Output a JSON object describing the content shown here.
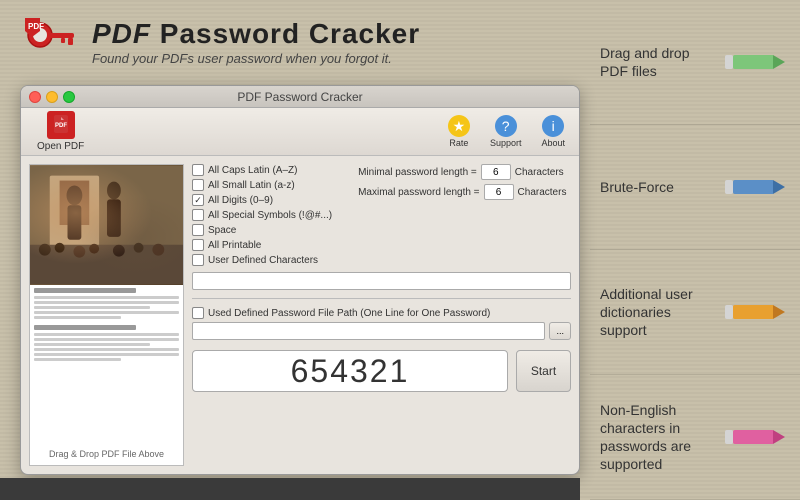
{
  "header": {
    "title_part1": "PDF",
    "title_part2": "Password Cracker",
    "subtitle": "Found your PDFs user password when you forgot it.",
    "logo_alt": "PDF Password Cracker logo"
  },
  "window": {
    "title": "PDF Password Cracker",
    "toolbar": {
      "open_pdf_label": "Open PDF",
      "rate_label": "Rate",
      "support_label": "Support",
      "about_label": "About"
    }
  },
  "checkboxes": [
    {
      "id": "all_caps",
      "label": "All Caps Latin (A–Z)",
      "checked": false
    },
    {
      "id": "all_small",
      "label": "All Small Latin (a-z)",
      "checked": false
    },
    {
      "id": "all_digits",
      "label": "All Digits (0–9)",
      "checked": true
    },
    {
      "id": "all_special",
      "label": "All Special Symbols (!@#...)",
      "checked": false
    },
    {
      "id": "space",
      "label": "Space",
      "checked": false
    },
    {
      "id": "all_printable",
      "label": "All Printable",
      "checked": false
    },
    {
      "id": "user_defined",
      "label": "User Defined Characters",
      "checked": false
    }
  ],
  "password_length": {
    "minimal_label": "Minimal password length =",
    "maximal_label": "Maximal password length =",
    "minimal_value": "6",
    "maximal_value": "6",
    "unit": "Characters"
  },
  "file_path": {
    "checkbox_label": "Used Defined Password File Path (One Line for One Password)",
    "checked": false,
    "browse_label": "...",
    "placeholder": ""
  },
  "password_display": {
    "value": "654321",
    "start_button": "Start"
  },
  "pdf_preview": {
    "drag_label": "Drag & Drop PDF File Above"
  },
  "features": [
    {
      "text": "Drag and drop PDF files",
      "pencil_color": "green"
    },
    {
      "text": "Brute-Force",
      "pencil_color": "blue"
    },
    {
      "text": "Additional user dictionaries support",
      "pencil_color": "orange"
    },
    {
      "text": "Non-English characters in passwords are supported",
      "pencil_color": "pink"
    }
  ]
}
